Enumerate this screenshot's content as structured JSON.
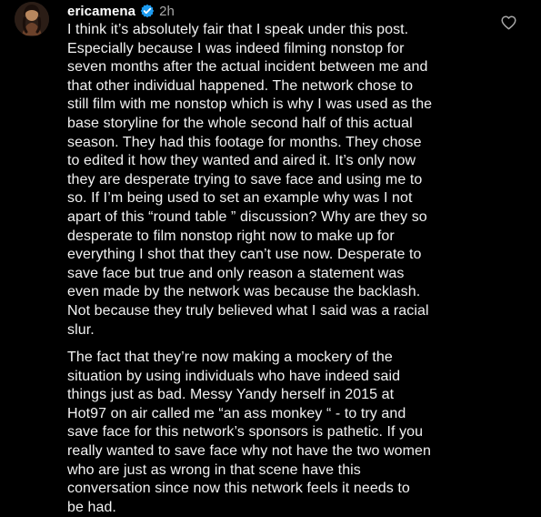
{
  "comment": {
    "username": "ericamena",
    "time": "2h",
    "verified_icon": "verified-badge-icon",
    "like_icon": "heart-outline-icon",
    "paragraphs": [
      {
        "lines": [
          "I think it’s absolutely fair that I speak under this post.",
          "Especially because I was indeed filming nonstop for",
          "seven months after the actual incident between me and",
          "that other individual happened. The network chose to",
          "still film with me nonstop which is why I was used as the",
          "base storyline for the whole second half of this actual",
          "season. They had this footage for months. They chose",
          "to edited it how they wanted and aired it. It’s only now",
          "they are desperate trying to save face and using me to",
          "so. If I’m being used to set an example why was I not",
          "apart of this “round table ” discussion? Why are they so",
          "desperate to film nonstop right now to make up for",
          "everything I shot that they can’t use now. Desperate to",
          "save face but true and  only reason a statement was",
          "even made by the network was because the backlash.",
          "Not because they truly believed what I said was a racial",
          "slur."
        ]
      },
      {
        "lines": [
          "The fact that they’re now making a mockery of the",
          "situation by using individuals who have indeed said",
          "things just as bad. Messy Yandy herself in 2015 at",
          "Hot97 on air called me “an ass monkey “ - to try and",
          "save face for this network’s sponsors is pathetic. If you",
          "really wanted to save face why not have the two women",
          "who are just as wrong in that scene have this",
          "conversation since now  this network feels it needs to",
          "be had."
        ]
      }
    ]
  },
  "colors": {
    "background": "#000000",
    "text": "#f2f2f2",
    "muted": "#a8a8a8",
    "verified": "#1d9bf0"
  }
}
